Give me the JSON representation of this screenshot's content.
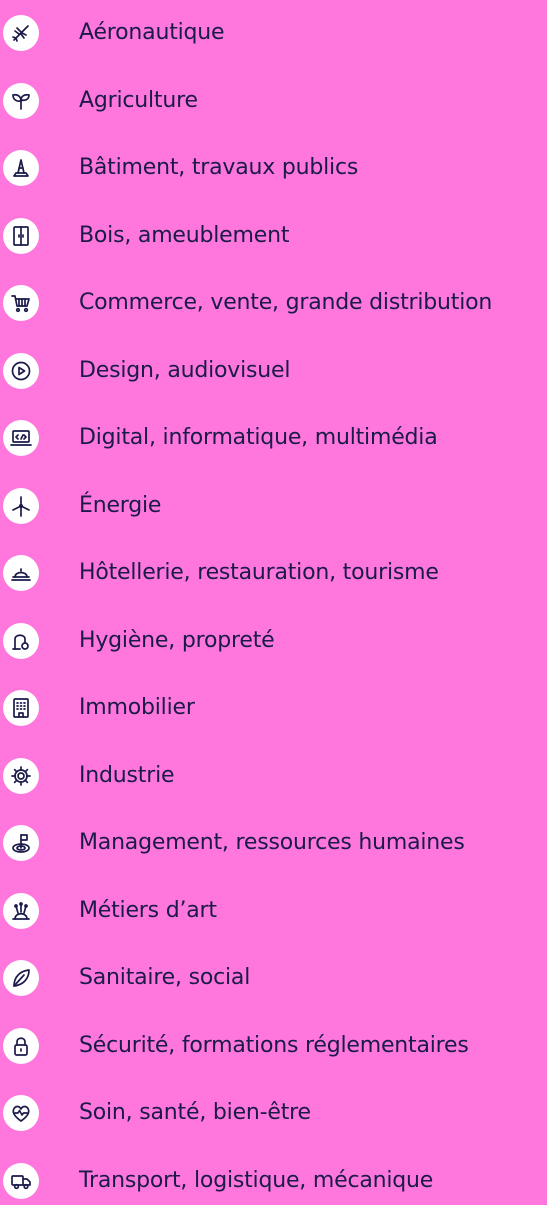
{
  "theme": {
    "background": "#ff76dd",
    "icon_badge": "#ffffff",
    "icon_stroke": "#1a1b49",
    "text": "#1a1b49"
  },
  "sectors": [
    {
      "label": "Aéronautique",
      "icon": "plane-icon"
    },
    {
      "label": "Agriculture",
      "icon": "sprout-icon"
    },
    {
      "label": "Bâtiment, travaux publics",
      "icon": "traffic-cone-icon"
    },
    {
      "label": "Bois, ameublement",
      "icon": "wardrobe-icon"
    },
    {
      "label": "Commerce, vente, grande distribution",
      "icon": "shopping-cart-icon"
    },
    {
      "label": "Design, audiovisuel",
      "icon": "play-circle-icon"
    },
    {
      "label": "Digital, informatique, multimédia",
      "icon": "laptop-icon"
    },
    {
      "label": "Énergie",
      "icon": "wind-turbine-icon"
    },
    {
      "label": "Hôtellerie, restauration, tourisme",
      "icon": "cloche-icon"
    },
    {
      "label": "Hygiène, propreté",
      "icon": "vacuum-cleaner-icon"
    },
    {
      "label": "Immobilier",
      "icon": "building-icon"
    },
    {
      "label": "Industrie",
      "icon": "gear-icon"
    },
    {
      "label": "Management, ressources humaines",
      "icon": "target-flag-icon"
    },
    {
      "label": "Métiers d’art",
      "icon": "pincushion-icon"
    },
    {
      "label": "Sanitaire, social",
      "icon": "leaf-icon"
    },
    {
      "label": "Sécurité, formations réglementaires",
      "icon": "padlock-icon"
    },
    {
      "label": "Soin, santé, bien-être",
      "icon": "heart-pulse-icon"
    },
    {
      "label": "Transport, logistique, mécanique",
      "icon": "truck-icon"
    }
  ]
}
